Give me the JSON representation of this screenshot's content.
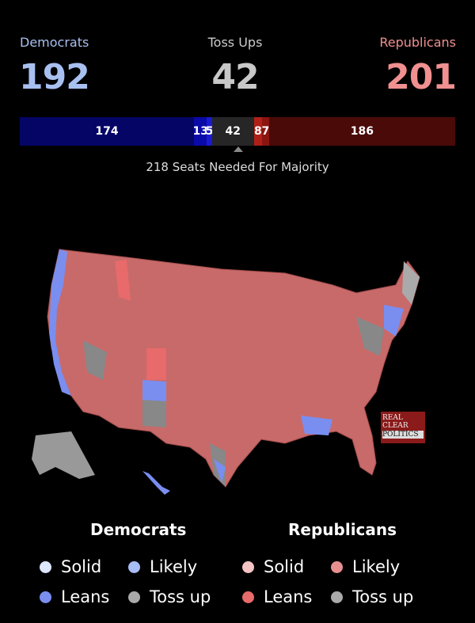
{
  "summary": {
    "democrats": {
      "label": "Democrats",
      "total": "192",
      "color": "#a8c0f0"
    },
    "tossups": {
      "label": "Toss Ups",
      "total": "42",
      "color": "#c8c8c8"
    },
    "republicans": {
      "label": "Republicans",
      "total": "201",
      "color": "#f09090"
    }
  },
  "seat_bar": {
    "segments": [
      {
        "category": "Dem Solid",
        "seats": 174,
        "label": "174",
        "color": "#050566"
      },
      {
        "category": "Dem Likely",
        "seats": 13,
        "label": "13",
        "color": "#0a0aa8"
      },
      {
        "category": "Dem Leans",
        "seats": 5,
        "label": "5",
        "color": "#1a1ad0"
      },
      {
        "category": "Toss Up",
        "seats": 42,
        "label": "42",
        "color": "#262626"
      },
      {
        "category": "Rep Leans",
        "seats": 8,
        "label": "8",
        "color": "#b02018"
      },
      {
        "category": "Rep Likely",
        "seats": 7,
        "label": "7",
        "color": "#8a1510"
      },
      {
        "category": "Rep Solid",
        "seats": 186,
        "label": "186",
        "color": "#4a0a08"
      }
    ],
    "majority_text": "218 Seats Needed For Majority"
  },
  "logo": {
    "lines": [
      "REAL",
      "CLEAR",
      "POLITICS"
    ]
  },
  "legend": {
    "democrats": {
      "title": "Democrats",
      "items": [
        {
          "label": "Solid",
          "color": "#dde6ff"
        },
        {
          "label": "Likely",
          "color": "#a8bcf5"
        },
        {
          "label": "Leans",
          "color": "#7a8ef0"
        },
        {
          "label": "Toss up",
          "color": "#aaaaaa"
        }
      ]
    },
    "republicans": {
      "title": "Republicans",
      "items": [
        {
          "label": "Solid",
          "color": "#f5c4c4"
        },
        {
          "label": "Likely",
          "color": "#e89090"
        },
        {
          "label": "Leans",
          "color": "#e86a6a"
        },
        {
          "label": "Toss up",
          "color": "#aaaaaa"
        }
      ]
    }
  }
}
